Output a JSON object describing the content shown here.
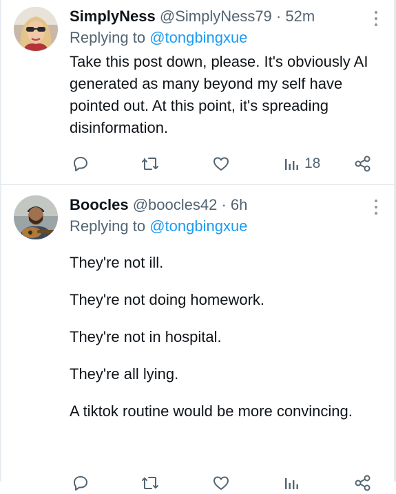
{
  "tweets": [
    {
      "name": "SimplyNess",
      "handle": "@SimplyNess79",
      "time": "52m",
      "replying_prefix": "Replying to",
      "replying_to": "@tongbingxue",
      "text": [
        "Take this post down, please. It's obviously AI generated as many beyond my self have pointed out. At this point, it's spreading disinformation."
      ],
      "views": "18"
    },
    {
      "name": "Boocles",
      "handle": "@boocles42",
      "time": "6h",
      "replying_prefix": "Replying to",
      "replying_to": "@tongbingxue",
      "text": [
        "They're not ill.",
        "They're not doing homework.",
        "They're not in hospital.",
        "They're all lying.",
        "A tiktok routine would be more convincing."
      ]
    }
  ],
  "separator": " · ",
  "colors": {
    "link": "#1d9bf0",
    "muted": "#536471",
    "icon": "#536471"
  },
  "icons": [
    "reply-icon",
    "retweet-icon",
    "like-icon",
    "views-icon",
    "share-icon",
    "more-icon"
  ]
}
